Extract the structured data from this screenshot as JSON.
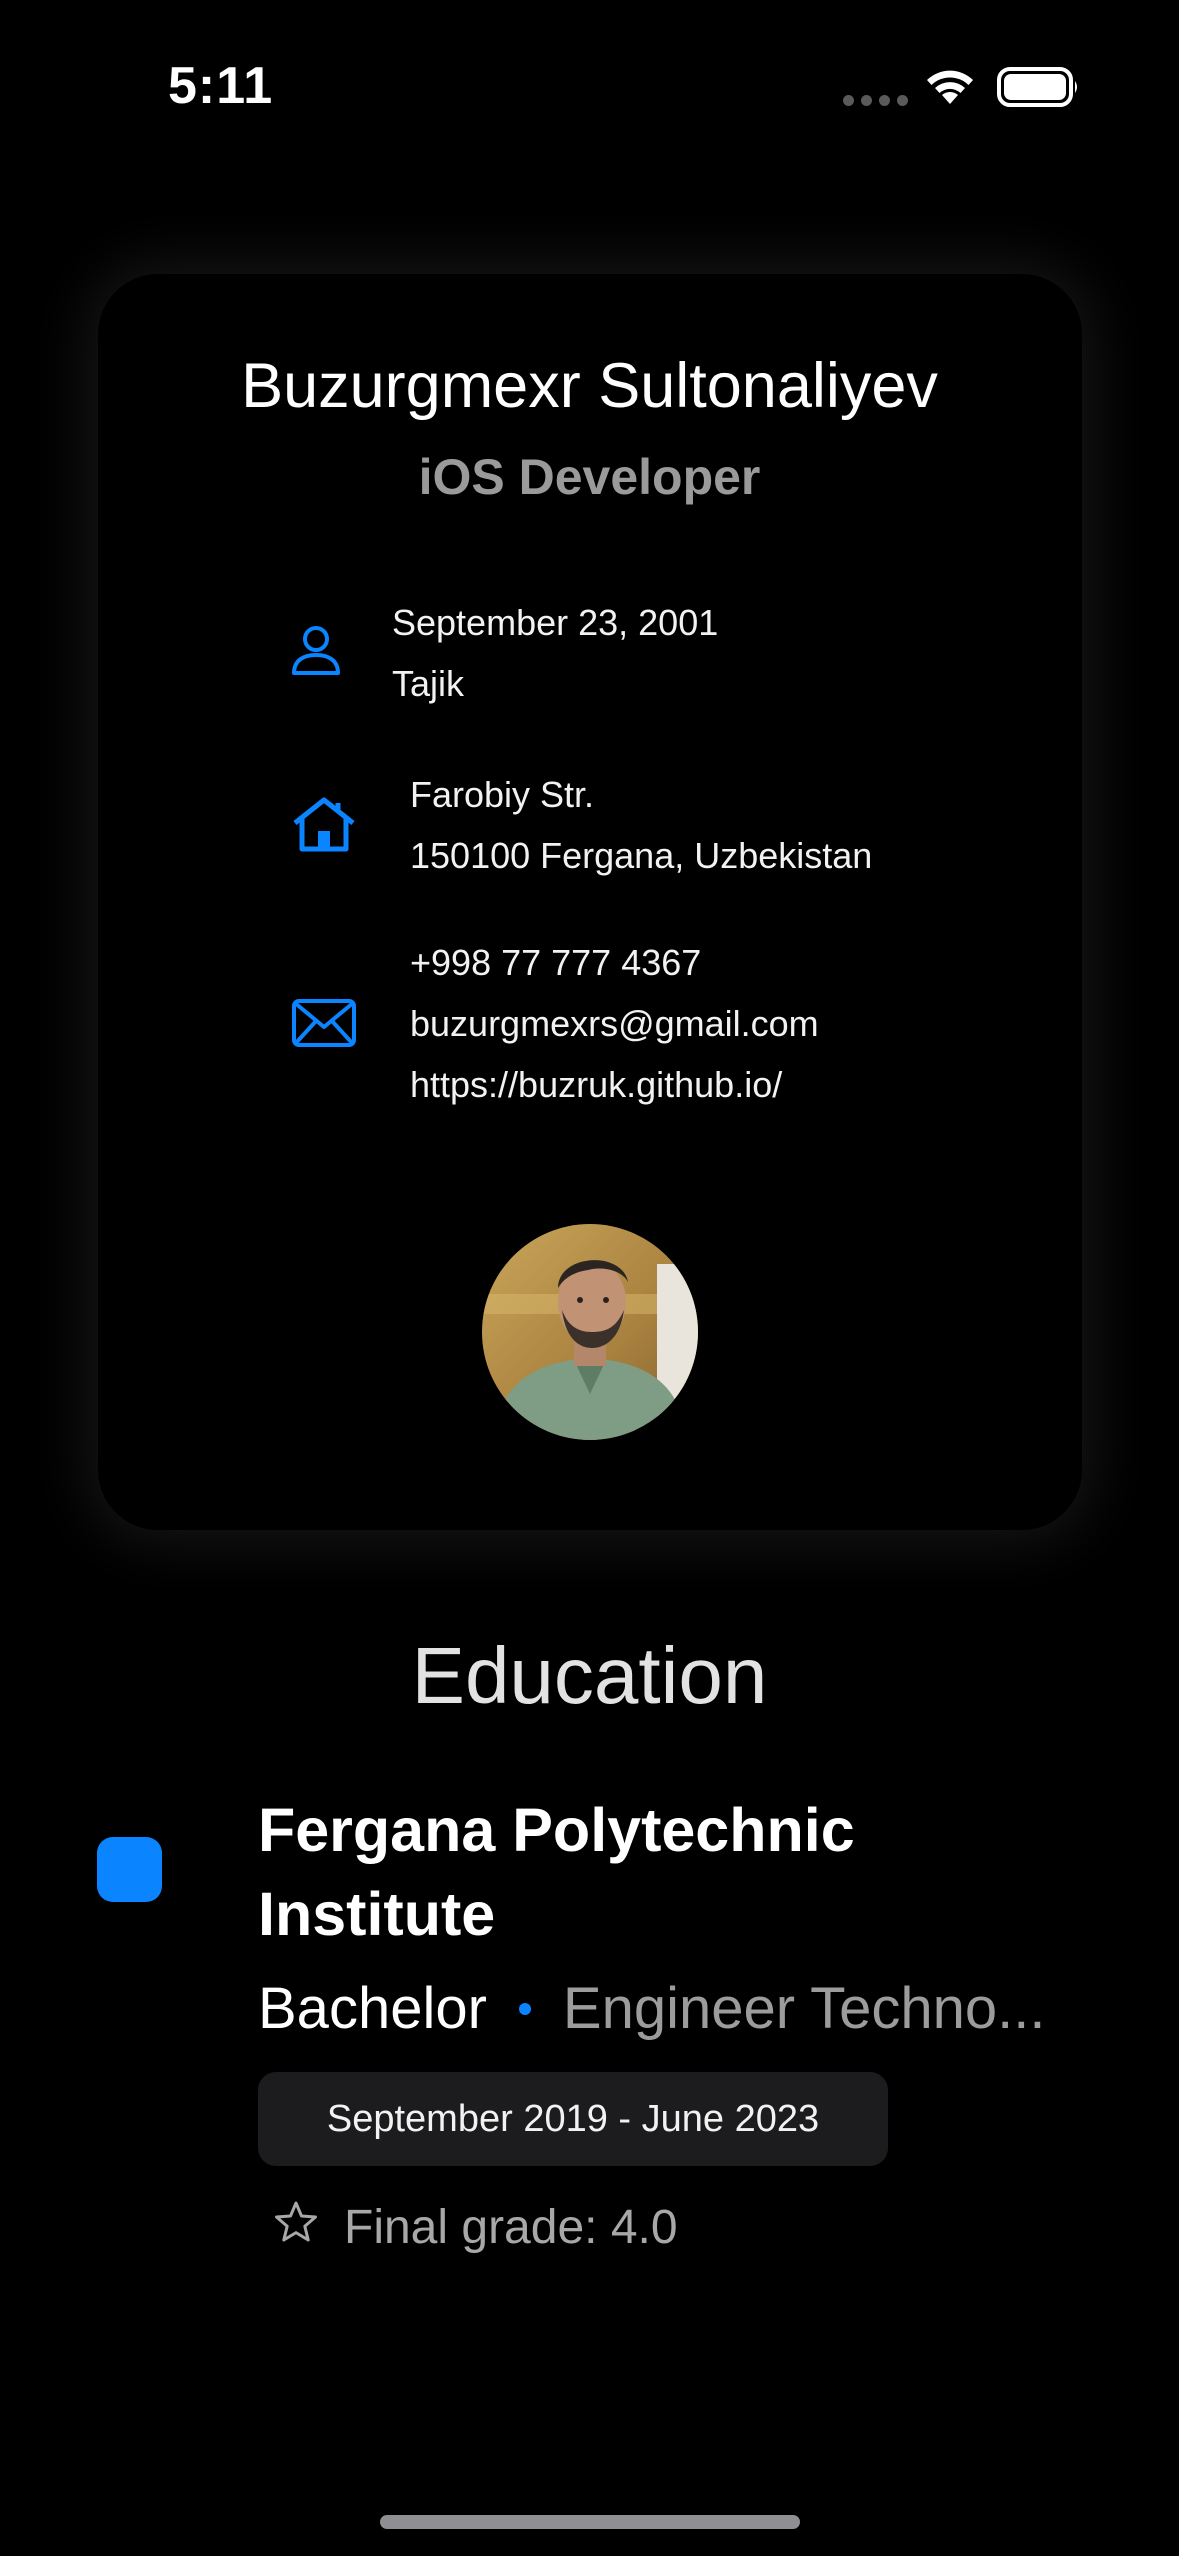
{
  "status_bar": {
    "time": "5:11"
  },
  "profile": {
    "name": "Buzurgmexr Sultonaliyev",
    "role": "iOS Developer",
    "personal": {
      "icon": "person-icon",
      "birth_date": "September 23, 2001",
      "nationality": "Tajik"
    },
    "address": {
      "icon": "house-icon",
      "street": "Farobiy Str.",
      "city": "150100 Fergana, Uzbekistan"
    },
    "contact": {
      "icon": "envelope-icon",
      "phone": "+998 77 777 4367",
      "email": "buzurgmexrs@gmail.com",
      "website": "https://buzruk.github.io/"
    }
  },
  "education": {
    "title": "Education",
    "items": [
      {
        "school": "Fergana Polytechnic Institute",
        "degree": "Bachelor",
        "field": "Engineer Techno...",
        "dates": "September 2019 - June 2023",
        "grade": "Final grade: 4.0"
      }
    ]
  },
  "colors": {
    "accent": "#0a84ff",
    "background": "#000000",
    "secondary_text": "#9a9a9a",
    "pill_background": "#1c1c1e"
  }
}
